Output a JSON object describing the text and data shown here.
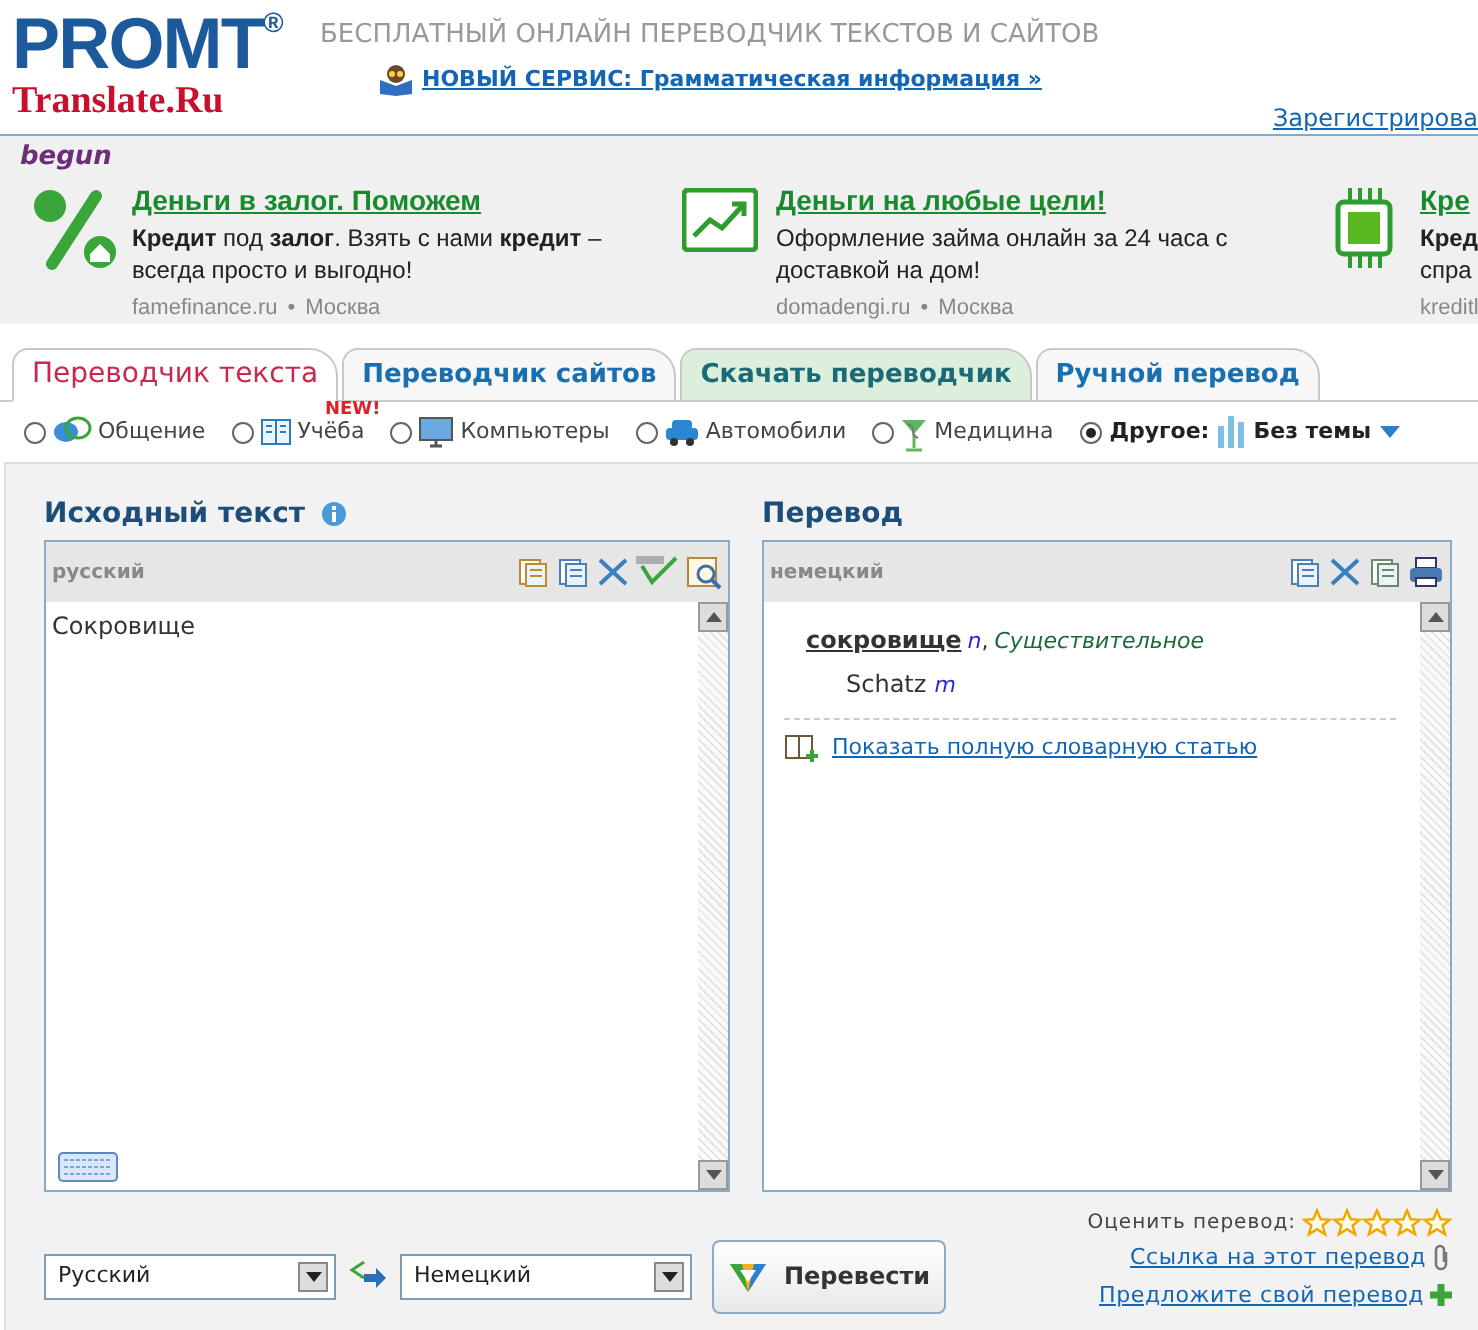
{
  "header": {
    "logo_top": "PROMT",
    "logo_reg": "®",
    "logo_bottom": "Translate.Ru",
    "tagline": "БЕСПЛАТНЫЙ ОНЛАЙН ПЕРЕВОДЧИК ТЕКСТОВ И САЙТОВ",
    "news_link": "НОВЫЙ СЕРВИС: Грамматическая информация »",
    "register_link": "Зарегистрирова"
  },
  "ads": {
    "label": "begun",
    "items": [
      {
        "title": "Деньги в залог. Поможем",
        "text": "**Кредит** под **залог**. Взять с нами **кредит** – всегда просто и выгодно!",
        "site": "famefinance.ru",
        "sep": "•",
        "city": "Москва"
      },
      {
        "title": "Деньги на любые цели!",
        "text": "Оформление займа онлайн за 24 часа с доставкой на дом!",
        "site": "domadengi.ru",
        "sep": "•",
        "city": "Москва"
      },
      {
        "title": "Кре",
        "text": "**Кред** спра",
        "site": "kreditl"
      }
    ]
  },
  "tabs": [
    {
      "label": "Переводчик текста",
      "selected": true,
      "kind": "normal"
    },
    {
      "label": "Переводчик сайтов",
      "selected": false,
      "kind": "normal"
    },
    {
      "label": "Скачать переводчик",
      "selected": false,
      "kind": "download"
    },
    {
      "label": "Ручной перевод",
      "selected": false,
      "kind": "normal"
    }
  ],
  "topics": [
    {
      "kind": "radio",
      "label": "Общение",
      "selected": false
    },
    {
      "kind": "radio",
      "label": "Учёба",
      "badge": "NEW!",
      "selected": false
    },
    {
      "kind": "radio",
      "label": "Компьютеры",
      "selected": false
    },
    {
      "kind": "radio",
      "label": "Автомобили",
      "selected": false
    },
    {
      "kind": "radio",
      "label": "Медицина",
      "selected": false
    },
    {
      "kind": "dropdown",
      "label": "Другое:",
      "value": "Без темы",
      "selected": true
    }
  ],
  "source": {
    "title": "Исходный текст",
    "language": "русский",
    "text": "Сокровище"
  },
  "target": {
    "title": "Перевод",
    "language": "немецкий",
    "word": "сокровище",
    "pos_tag": "n",
    "pos_sep": ",",
    "pos": "Существительное",
    "translation": "Schatz",
    "gender": "m",
    "dict_link": "Показать полную словарную статью"
  },
  "controls": {
    "from": "Русский",
    "to": "Немецкий",
    "translate_button": "Перевести",
    "rate_label": "Оценить перевод:",
    "stars": 0,
    "link_permalink": "Ссылка на этот перевод",
    "link_suggest": "Предложите свой перевод"
  }
}
